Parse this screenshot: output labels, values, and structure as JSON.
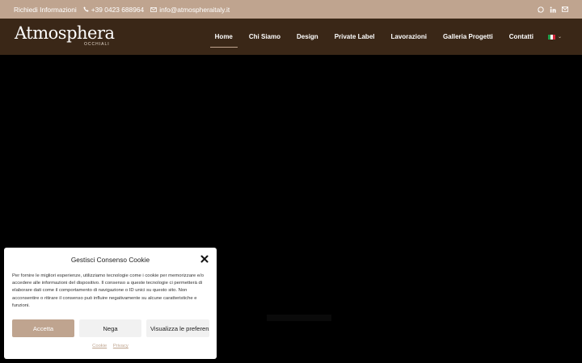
{
  "topbar": {
    "info_label": "Richiedi Informazioni",
    "phone": "+39 0423 688964",
    "email": "info@atmospheraitaly.it",
    "social_icons": [
      "whatsapp-icon",
      "linkedin-icon",
      "email-icon"
    ]
  },
  "header": {
    "logo_text": "Atmosphera",
    "logo_sub": "OCCHIALI",
    "menu": [
      {
        "label": "Home",
        "active": true
      },
      {
        "label": "Chi Siamo"
      },
      {
        "label": "Design"
      },
      {
        "label": "Private Label"
      },
      {
        "label": "Lavorazioni"
      },
      {
        "label": "Galleria Progetti"
      },
      {
        "label": "Contatti"
      }
    ],
    "language_flag": "italy-flag-icon"
  },
  "cookie": {
    "title": "Gestisci Consenso Cookie",
    "text": "Per fornire le migliori esperienze, utilizziamo tecnologie come i cookie per memorizzare e/o accedere alle informazioni del dispositivo. Il consenso a queste tecnologie ci permetterà di elaborare dati come il comportamento di navigazione o ID unici su questo sito. Non acconsentire o ritirare il consenso può influire negativamente su alcune caratteristiche e funzioni.",
    "accept_label": "Accetta",
    "deny_label": "Nega",
    "prefs_label": "Visualizza le preferenze",
    "links": [
      "Cookie",
      "Privacy"
    ]
  },
  "colors": {
    "accent": "#bfa48f",
    "nav_bg": "#3a2717"
  }
}
